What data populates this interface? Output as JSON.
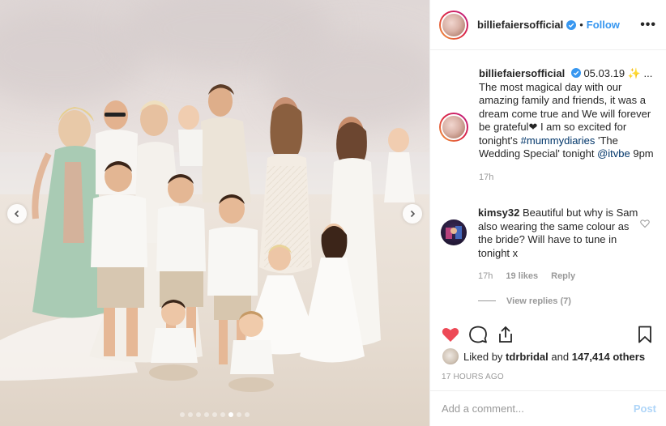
{
  "post": {
    "username": "billiefaiersofficial",
    "follow_label": "Follow",
    "bullet": "•",
    "more_label": "•••"
  },
  "caption": {
    "username": "billiefaiersofficial",
    "date": "05.03.19",
    "sparkle": "✨",
    "text_start": "... The most magical day with our amazing family and friends, it was a dream come true and We will forever be grateful",
    "heart_emoji": "❤",
    "text_mid": " I am so excited for tonight's ",
    "hashtag": "#mummydiaries",
    "text_mid2": " 'The Wedding Special' tonight ",
    "mention": "@itvbe",
    "text_end": " 9pm",
    "time_ago": "17h"
  },
  "comment": {
    "username": "kimsy32",
    "text": "Beautiful but why is Sam also wearing the same colour as the bride? Will have to tune in tonight x",
    "time_ago": "17h",
    "likes": "19 likes",
    "reply_label": "Reply",
    "view_replies": "View replies (7)"
  },
  "likes": {
    "prefix": "Liked by ",
    "liker": "tdrbridal",
    "middle": " and ",
    "count": "147,414 others"
  },
  "timestamp": "17 HOURS AGO",
  "add_comment": {
    "placeholder": "Add a comment...",
    "post_label": "Post"
  },
  "carousel": {
    "count": 9,
    "active_index": 6
  },
  "colors": {
    "link_blue": "#3897f0",
    "like_red": "#ed4956",
    "hashtag_blue": "#003569",
    "muted_gray": "#999999"
  }
}
